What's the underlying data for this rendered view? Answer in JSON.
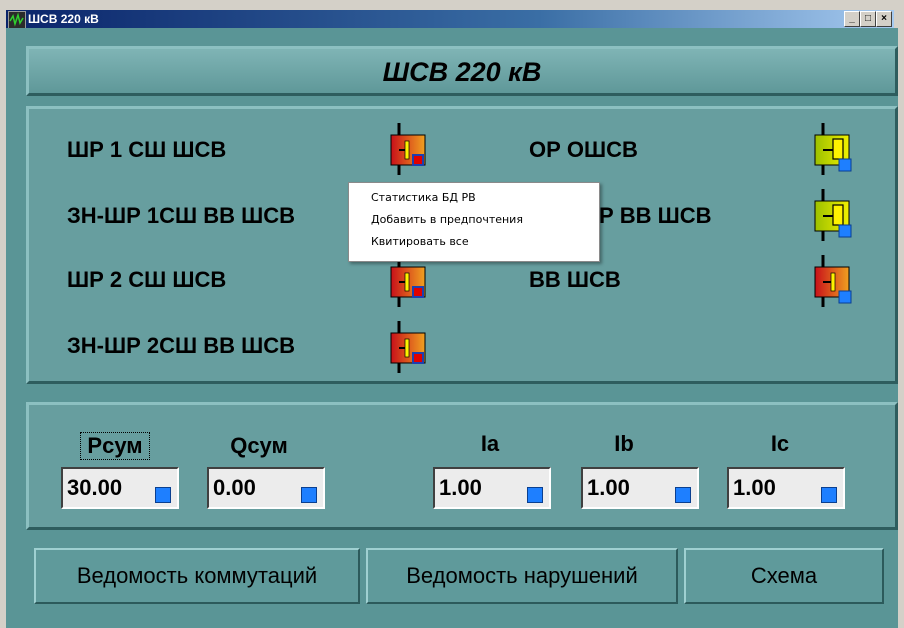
{
  "window": {
    "title": "ШСВ 220 кВ",
    "controls": {
      "minimize": "_",
      "maximize": "□",
      "close": "×"
    }
  },
  "header": {
    "title": "ШСВ 220 кВ"
  },
  "switches": [
    {
      "label": "ШР 1 СШ ШСВ",
      "icon": "disconnector-icon",
      "state_color": "red"
    },
    {
      "label": "ЗН-ШР 1СШ ВВ ШСВ",
      "icon": "disconnector-icon",
      "state_color": "red"
    },
    {
      "label": "ШР 2 СШ ШСВ",
      "icon": "disconnector-icon",
      "state_color": "red"
    },
    {
      "label": "ЗН-ШР 2СШ ВВ ШСВ",
      "icon": "disconnector-icon",
      "state_color": "red"
    },
    {
      "label": "ОР ОШСВ",
      "icon": "disconnector-icon",
      "state_color": "yellow-green"
    },
    {
      "label": "Р ВВ ШСВ",
      "icon": "disconnector-icon",
      "state_color": "yellow-green"
    },
    {
      "label": "ВВ ШСВ",
      "icon": "breaker-icon",
      "state_color": "red"
    }
  ],
  "measurements": [
    {
      "label": "Pсум",
      "value": "30.00"
    },
    {
      "label": "Qсум",
      "value": "0.00"
    },
    {
      "label": "Ia",
      "value": "1.00"
    },
    {
      "label": "Ib",
      "value": "1.00"
    },
    {
      "label": "Ic",
      "value": "1.00"
    }
  ],
  "buttons": {
    "commutations": "Ведомость коммутаций",
    "violations": "Ведомость нарушений",
    "scheme": "Схема"
  },
  "context_menu": [
    "Статистика БД РВ",
    "Добавить в предпочтения",
    "Квитировать все"
  ],
  "colors": {
    "background": "#5a9596",
    "panel": "#679e9f",
    "indicator": "#1e7fff",
    "switch_red": "#d4361c",
    "switch_yellow": "#c8d800"
  }
}
